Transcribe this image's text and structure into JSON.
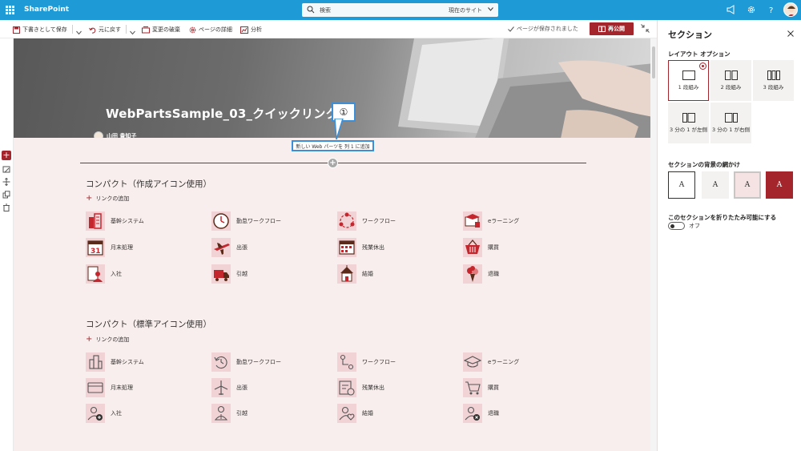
{
  "suitebar": {
    "app_name": "SharePoint",
    "search_placeholder": "検索",
    "search_scope": "現在のサイト"
  },
  "toolbar": {
    "save_draft": "下書きとして保存",
    "undo": "元に戻す",
    "discard": "変更の破棄",
    "page_details": "ページの詳細",
    "analytics": "分析",
    "saved_status": "ページが保存されました",
    "republish": "再公開"
  },
  "hero": {
    "title": "WebPartsSample_03_クイックリンク",
    "author": "山田 貴知子"
  },
  "annotation": {
    "callout_number": "①",
    "tooltip": "新しい Web パーツを 列 1 に追加"
  },
  "sections": [
    {
      "title": "コンパクト（作成アイコン使用）",
      "add_link": "リンクの追加",
      "links": [
        {
          "label": "基幹システム",
          "icon": "building-icon"
        },
        {
          "label": "勤怠ワークフロー",
          "icon": "clock-icon"
        },
        {
          "label": "ワークフロー",
          "icon": "workflow-icon"
        },
        {
          "label": "eラーニング",
          "icon": "elearning-icon"
        },
        {
          "label": "月末処理",
          "icon": "calendar-31-icon"
        },
        {
          "label": "出張",
          "icon": "airplane-icon"
        },
        {
          "label": "残業休出",
          "icon": "calendar-grid-icon"
        },
        {
          "label": "購買",
          "icon": "basket-icon"
        },
        {
          "label": "入社",
          "icon": "new-hire-icon"
        },
        {
          "label": "引越",
          "icon": "moving-truck-icon"
        },
        {
          "label": "結婚",
          "icon": "chapel-icon"
        },
        {
          "label": "退職",
          "icon": "flower-bouquet-icon"
        }
      ]
    },
    {
      "title": "コンパクト（標準アイコン使用）",
      "add_link": "リンクの追加",
      "links": [
        {
          "label": "基幹システム",
          "icon": "city-icon"
        },
        {
          "label": "勤怠ワークフロー",
          "icon": "history-icon"
        },
        {
          "label": "ワークフロー",
          "icon": "flow-icon"
        },
        {
          "label": "eラーニング",
          "icon": "graduation-cap-icon"
        },
        {
          "label": "月末処理",
          "icon": "payment-card-icon"
        },
        {
          "label": "出張",
          "icon": "airplane-outline-icon"
        },
        {
          "label": "残業休出",
          "icon": "timesheet-icon"
        },
        {
          "label": "購買",
          "icon": "shopping-cart-icon"
        },
        {
          "label": "入社",
          "icon": "add-person-icon"
        },
        {
          "label": "引越",
          "icon": "person-arrow-icon"
        },
        {
          "label": "結婚",
          "icon": "person-heart-icon"
        },
        {
          "label": "退職",
          "icon": "remove-person-icon"
        }
      ]
    }
  ],
  "panel": {
    "title": "セクション",
    "layout_heading": "レイアウト オプション",
    "layouts": [
      "1 段組み",
      "2 段組み",
      "3 段組み",
      "3 分の 1 が左側",
      "3 分の 1 が右側"
    ],
    "selected_layout": "1 段組み",
    "background_heading": "セクションの背景の網かけ",
    "background_sample": "A",
    "collapsible_heading": "このセクションを折りたたみ可能にする",
    "toggle_state": "オフ"
  },
  "colors": {
    "suitebar": "#1e9bd7",
    "accent": "#a4262c",
    "icon_bg": "#f2d3d5",
    "section_bg": "#f9eeee"
  }
}
